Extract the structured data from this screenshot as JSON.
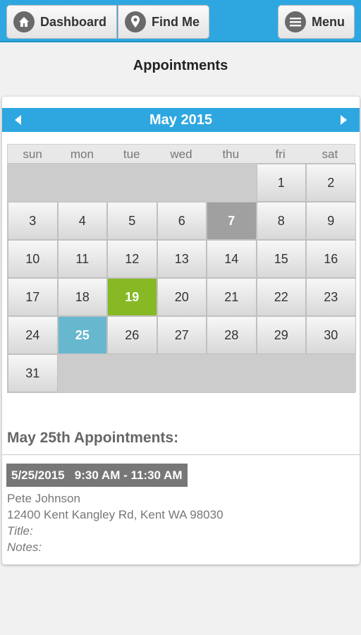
{
  "nav": {
    "dashboard_label": "Dashboard",
    "findme_label": "Find Me",
    "menu_label": "Menu"
  },
  "page": {
    "title": "Appointments"
  },
  "calendar": {
    "month_label": "May 2015",
    "weekdays": [
      "sun",
      "mon",
      "tue",
      "wed",
      "thu",
      "fri",
      "sat"
    ],
    "leading_blank_days": 5,
    "days_in_month": 31,
    "today": 7,
    "appointment_day": 19,
    "selected_day": 25
  },
  "appointments": {
    "heading": "May 25th Appointments:",
    "items": [
      {
        "datetime": "5/25/2015   9:30 AM - 11:30 AM",
        "name": "Pete Johnson",
        "address": "12400 Kent Kangley Rd, Kent WA 98030",
        "title_label": "Title:",
        "notes_label": "Notes:"
      }
    ]
  },
  "colors": {
    "accent": "#2ea7e0",
    "today": "#a0a0a0",
    "appointment_day": "#86b923",
    "selected_day": "#67b8cf"
  }
}
